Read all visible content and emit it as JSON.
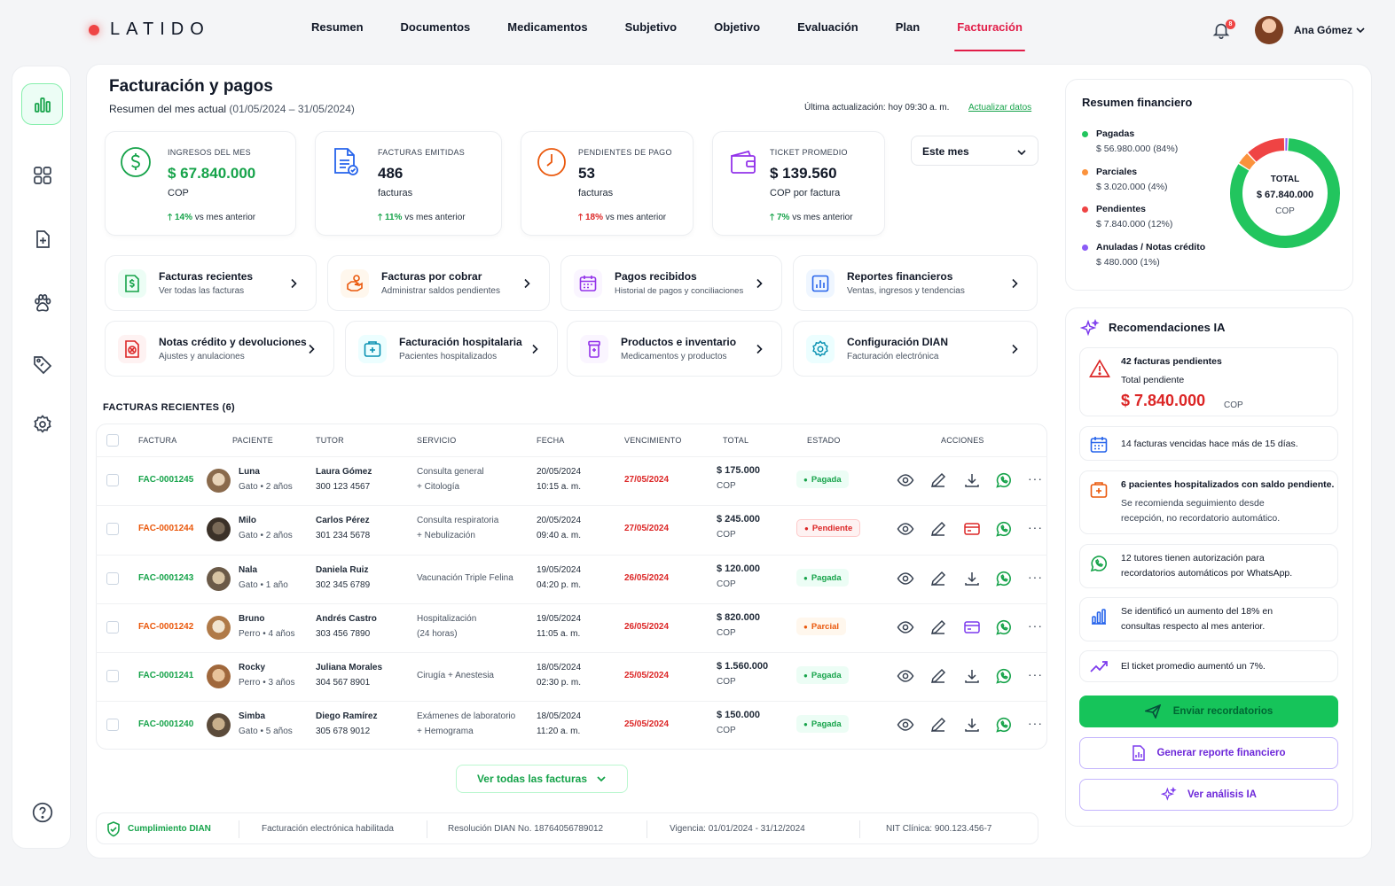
{
  "brand": {
    "logo_text": "LATIDO"
  },
  "nav": {
    "items": [
      "Resumen",
      "Documentos",
      "Medicamentos",
      "Subjetivo",
      "Objetivo",
      "Evaluación",
      "Plan",
      "Facturación"
    ],
    "active": "Facturación"
  },
  "user": {
    "name": "Ana Gómez",
    "notifications": "8"
  },
  "page": {
    "title": "Facturación y pagos",
    "subtitle_label": "Resumen del mes actual",
    "subtitle_range": "(01/05/2024 – 31/05/2024)",
    "last_update": "Última actualización: hoy 09:30 a. m.",
    "update_link": "Actualizar datos"
  },
  "kpis": [
    {
      "label": "INGRESOS DEL MES",
      "value": "$ 67.840.000",
      "unit": "COP",
      "change": "14%",
      "change_text": " vs mes anterior",
      "dir": "up"
    },
    {
      "label": "FACTURAS EMITIDAS",
      "value": "486",
      "unit": "facturas",
      "change": "11%",
      "change_text": " vs mes anterior",
      "dir": "up"
    },
    {
      "label": "PENDIENTES DE PAGO",
      "value": "53",
      "unit": "facturas",
      "change": "18%",
      "change_text": " vs mes anterior",
      "dir": "down"
    },
    {
      "label": "TICKET PROMEDIO",
      "value": "$ 139.560",
      "unit": "COP por factura",
      "change": "7%",
      "change_text": " vs mes anterior",
      "dir": "up"
    }
  ],
  "period": {
    "selected": "Este mes"
  },
  "quick_actions": [
    {
      "title": "Facturas recientes",
      "desc": "Ver todas las facturas"
    },
    {
      "title": "Facturas por cobrar",
      "desc": "Administrar saldos pendientes"
    },
    {
      "title": "Pagos recibidos",
      "desc": "Historial de pagos y conciliaciones"
    },
    {
      "title": "Reportes financieros",
      "desc": "Ventas, ingresos y tendencias"
    },
    {
      "title": "Notas crédito y devoluciones",
      "desc": "Ajustes y anulaciones"
    },
    {
      "title": "Facturación hospitalaria",
      "desc": "Pacientes hospitalizados"
    },
    {
      "title": "Productos e inventario",
      "desc": "Medicamentos y productos"
    },
    {
      "title": "Configuración DIAN",
      "desc": "Facturación electrónica"
    }
  ],
  "invoices": {
    "title": "FACTURAS RECIENTES (6)",
    "columns": [
      "FACTURA",
      "PACIENTE",
      "TUTOR",
      "SERVICIO",
      "FECHA",
      "VENCIMIENTO",
      "TOTAL",
      "ESTADO",
      "ACCIONES"
    ],
    "rows": [
      {
        "id": "FAC-0001245",
        "pet": "Luna",
        "species": "Gato • 2 años",
        "tutor": "Laura Gómez",
        "phone": "300 123 4567",
        "service1": "Consulta general",
        "service2": "+ Citología",
        "date": "20/05/2024",
        "time": "10:15 a. m.",
        "due": "27/05/2024",
        "total": "$ 175.000",
        "currency": "COP",
        "status": "Pagada",
        "kind": "paid"
      },
      {
        "id": "FAC-0001244",
        "pet": "Milo",
        "species": "Gato • 2 años",
        "tutor": "Carlos Pérez",
        "phone": "301 234 5678",
        "service1": "Consulta respiratoria",
        "service2": "+ Nebulización",
        "date": "20/05/2024",
        "time": "09:40 a. m.",
        "due": "27/05/2024",
        "total": "$ 245.000",
        "currency": "COP",
        "status": "Pendiente",
        "kind": "pend"
      },
      {
        "id": "FAC-0001243",
        "pet": "Nala",
        "species": "Gato • 1 año",
        "tutor": "Daniela Ruiz",
        "phone": "302 345 6789",
        "service1": "Vacunación Triple Felina",
        "service2": "",
        "date": "19/05/2024",
        "time": "04:20 p. m.",
        "due": "26/05/2024",
        "total": "$ 120.000",
        "currency": "COP",
        "status": "Pagada",
        "kind": "paid"
      },
      {
        "id": "FAC-0001242",
        "pet": "Bruno",
        "species": "Perro • 4 años",
        "tutor": "Andrés Castro",
        "phone": "303 456 7890",
        "service1": "Hospitalización",
        "service2": "(24 horas)",
        "date": "19/05/2024",
        "time": "11:05 a. m.",
        "due": "26/05/2024",
        "total": "$ 820.000",
        "currency": "COP",
        "status": "Parcial",
        "kind": "part"
      },
      {
        "id": "FAC-0001241",
        "pet": "Rocky",
        "species": "Perro • 3 años",
        "tutor": "Juliana Morales",
        "phone": "304 567 8901",
        "service1": "Cirugía + Anestesia",
        "service2": "",
        "date": "18/05/2024",
        "time": "02:30 p. m.",
        "due": "25/05/2024",
        "total": "$ 1.560.000",
        "currency": "COP",
        "status": "Pagada",
        "kind": "paid"
      },
      {
        "id": "FAC-0001240",
        "pet": "Simba",
        "species": "Gato • 5 años",
        "tutor": "Diego Ramírez",
        "phone": "305 678 9012",
        "service1": "Exámenes de laboratorio",
        "service2": "+ Hemograma",
        "date": "18/05/2024",
        "time": "11:20 a. m.",
        "due": "25/05/2024",
        "total": "$ 150.000",
        "currency": "COP",
        "status": "Pagada",
        "kind": "paid"
      }
    ],
    "view_all": "Ver todas las facturas"
  },
  "footer": {
    "compliance": "Cumplimiento DIAN",
    "enabled": "Facturación electrónica habilitada",
    "resolution": "Resolución DIAN No. 18764056789012",
    "validity": "Vigencia: 01/01/2024 - 31/12/2024",
    "nit": "NIT Clínica: 900.123.456-7"
  },
  "financial": {
    "title": "Resumen financiero",
    "total_label": "TOTAL",
    "total_value": "$ 67.840.000",
    "total_unit": "COP",
    "segments": [
      {
        "name": "Pagadas",
        "value": "$ 56.980.000 (84%)",
        "pct": 84,
        "color": "#22c55e"
      },
      {
        "name": "Parciales",
        "value": "$ 3.020.000 (4%)",
        "pct": 4,
        "color": "#fb923c"
      },
      {
        "name": "Pendientes",
        "value": "$ 7.840.000 (12%)",
        "pct": 12,
        "color": "#ef4444"
      },
      {
        "name": "Anuladas / Notas crédito",
        "value": "$ 480.000 (1%)",
        "pct": 1,
        "color": "#8b5cf6"
      }
    ]
  },
  "ai": {
    "title": "Recomendaciones IA",
    "pending_count": "42 facturas pendientes",
    "pending_label": "Total pendiente",
    "pending_value": "$ 7.840.000",
    "pending_unit": "COP",
    "items": [
      "14 facturas vencidas hace más de 15 días.",
      "6 pacientes hospitalizados con saldo pendiente.",
      "Se recomienda seguimiento desde",
      "recepción, no recordatorio automático.",
      "12 tutores tienen autorización para",
      "recordatorios automáticos por WhatsApp.",
      "Se identificó un aumento del 18% en",
      "consultas respecto al mes anterior.",
      "El ticket promedio aumentó un 7%."
    ],
    "btn_reminders": "Enviar recordatorios",
    "btn_report": "Generar reporte financiero",
    "btn_analysis": "Ver análisis IA"
  },
  "colors": {
    "accent": "#e11d48",
    "green": "#16a34a",
    "red": "#dc2626",
    "orange": "#ea580c",
    "purple": "#6d28d9"
  }
}
